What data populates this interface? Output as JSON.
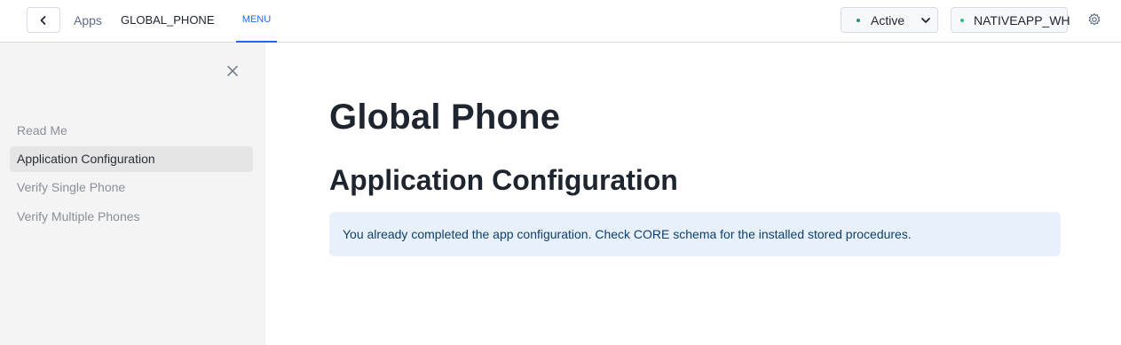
{
  "topbar": {
    "breadcrumb_apps": "Apps",
    "app_name": "GLOBAL_PHONE",
    "tab_menu": "MENU",
    "status": "Active",
    "warehouse": "NATIVEAPP_WH",
    "accent_color": "#1a6ce7",
    "status_dot_color": "#1f9d62"
  },
  "sidebar": {
    "items": [
      {
        "label": "Read Me"
      },
      {
        "label": "Application Configuration"
      },
      {
        "label": "Verify Single Phone"
      },
      {
        "label": "Verify Multiple Phones"
      }
    ],
    "active_item": "Application Configuration"
  },
  "main": {
    "title": "Global Phone",
    "section": "Application Configuration",
    "info_message": "You already completed the app configuration. Check CORE schema for the installed stored procedures."
  },
  "icons": {
    "back": "chevron-left-icon",
    "status_dropdown": "chevron-down-icon",
    "settings": "gear-icon",
    "close": "close-icon"
  }
}
